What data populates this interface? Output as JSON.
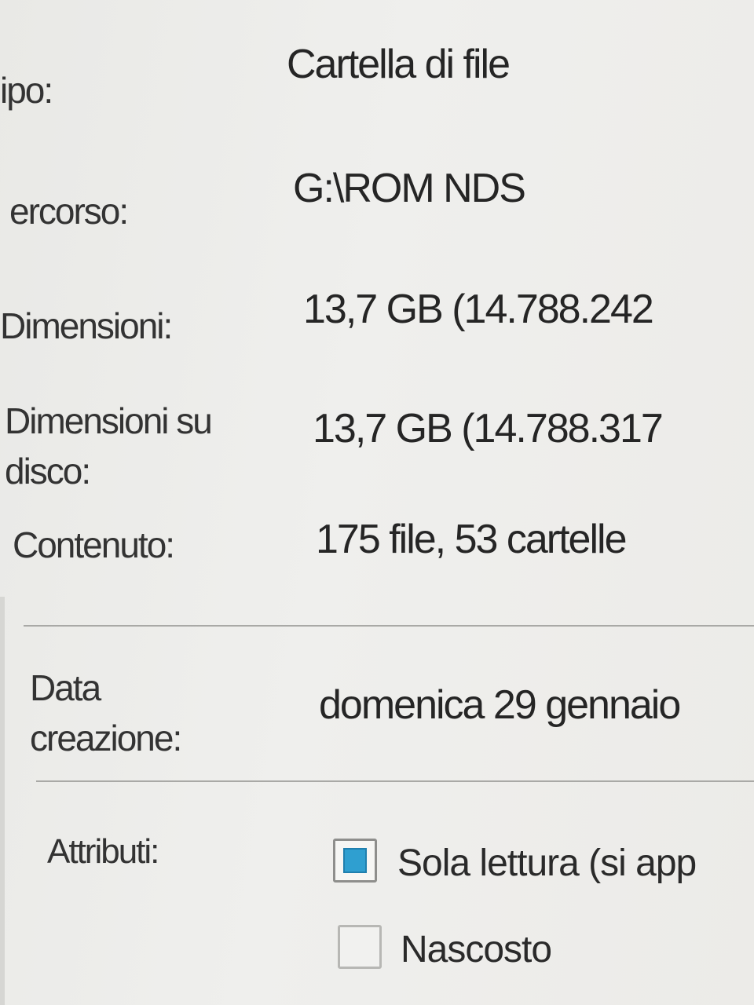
{
  "properties": {
    "tipo": {
      "label": "ipo:",
      "value": "Cartella di file"
    },
    "percorso": {
      "label": "ercorso:",
      "value": "G:\\ROM NDS"
    },
    "dimensioni": {
      "label": "Dimensioni:",
      "value": "13,7 GB (14.788.242"
    },
    "dimensioni_disco": {
      "label": "Dimensioni su disco:",
      "value": "13,7 GB (14.788.317"
    },
    "contenuto": {
      "label": "Contenuto:",
      "value": "175 file, 53 cartelle"
    },
    "data_creazione": {
      "label": "Data creazione:",
      "value": "domenica 29 gennaio"
    },
    "attributi": {
      "label": "Attributi:",
      "sola_lettura": "Sola lettura (si app",
      "nascosto": "Nascosto"
    }
  }
}
